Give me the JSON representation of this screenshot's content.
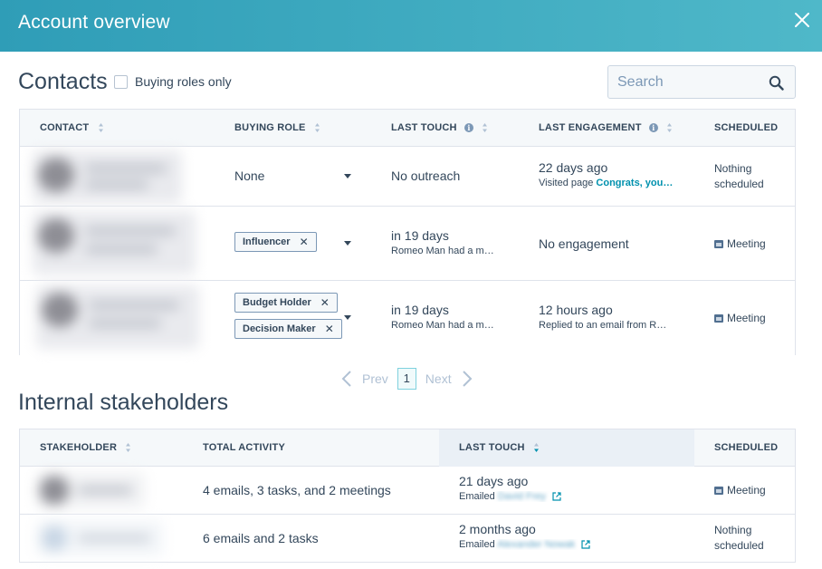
{
  "header": {
    "title": "Account overview"
  },
  "contacts": {
    "title": "Contacts",
    "buying_roles_only": "Buying roles only",
    "search_placeholder": "Search",
    "columns": {
      "contact": "CONTACT",
      "buying_role": "BUYING ROLE",
      "last_touch": "LAST TOUCH",
      "last_engagement": "LAST ENGAGEMENT",
      "scheduled": "SCHEDULED"
    },
    "rows": [
      {
        "role": "None",
        "last_touch": "No outreach",
        "engagement_main": "22 days ago",
        "engagement_sub_prefix": "Visited page ",
        "engagement_sub_link": "Congrats, you…",
        "scheduled_line1": "Nothing",
        "scheduled_line2": "scheduled"
      },
      {
        "tag1": "Influencer",
        "last_touch": "in 19 days",
        "last_touch_sub": "Romeo Man had a m…",
        "engagement_main": "No engagement",
        "scheduled": "Meeting"
      },
      {
        "tag1": "Budget Holder",
        "tag2": "Decision Maker",
        "last_touch": "in 19 days",
        "last_touch_sub": "Romeo Man had a m…",
        "engagement_main": "12 hours ago",
        "engagement_sub": "Replied to an email from R…",
        "scheduled": "Meeting"
      }
    ],
    "pagination": {
      "prev": "Prev",
      "page": "1",
      "next": "Next"
    }
  },
  "stakeholders": {
    "title": "Internal stakeholders",
    "columns": {
      "stakeholder": "STAKEHOLDER",
      "total_activity": "TOTAL ACTIVITY",
      "last_touch": "LAST TOUCH",
      "scheduled": "SCHEDULED"
    },
    "rows": [
      {
        "activity": "4 emails, 3 tasks, and 2 meetings",
        "last_touch": "21 days ago",
        "last_touch_prefix": "Emailed",
        "last_touch_name": "David Frey",
        "scheduled": "Meeting"
      },
      {
        "activity": "6 emails and 2 tasks",
        "last_touch": "2 months ago",
        "last_touch_prefix": "Emailed",
        "last_touch_name": "Alexander Nowak",
        "scheduled_line1": "Nothing",
        "scheduled_line2": "scheduled"
      }
    ]
  },
  "icons": {
    "close": "close-icon",
    "search": "search-icon",
    "sort": "sort-icon",
    "info": "info-icon",
    "calendar": "calendar-icon",
    "external": "external-link-icon",
    "chevron_left": "chevron-left-icon",
    "chevron_right": "chevron-right-icon"
  },
  "colors": {
    "header_start": "#2f9db7",
    "header_end": "#4fb8c9",
    "link": "#0091ae",
    "text": "#33475b",
    "border": "#dfe3eb"
  }
}
